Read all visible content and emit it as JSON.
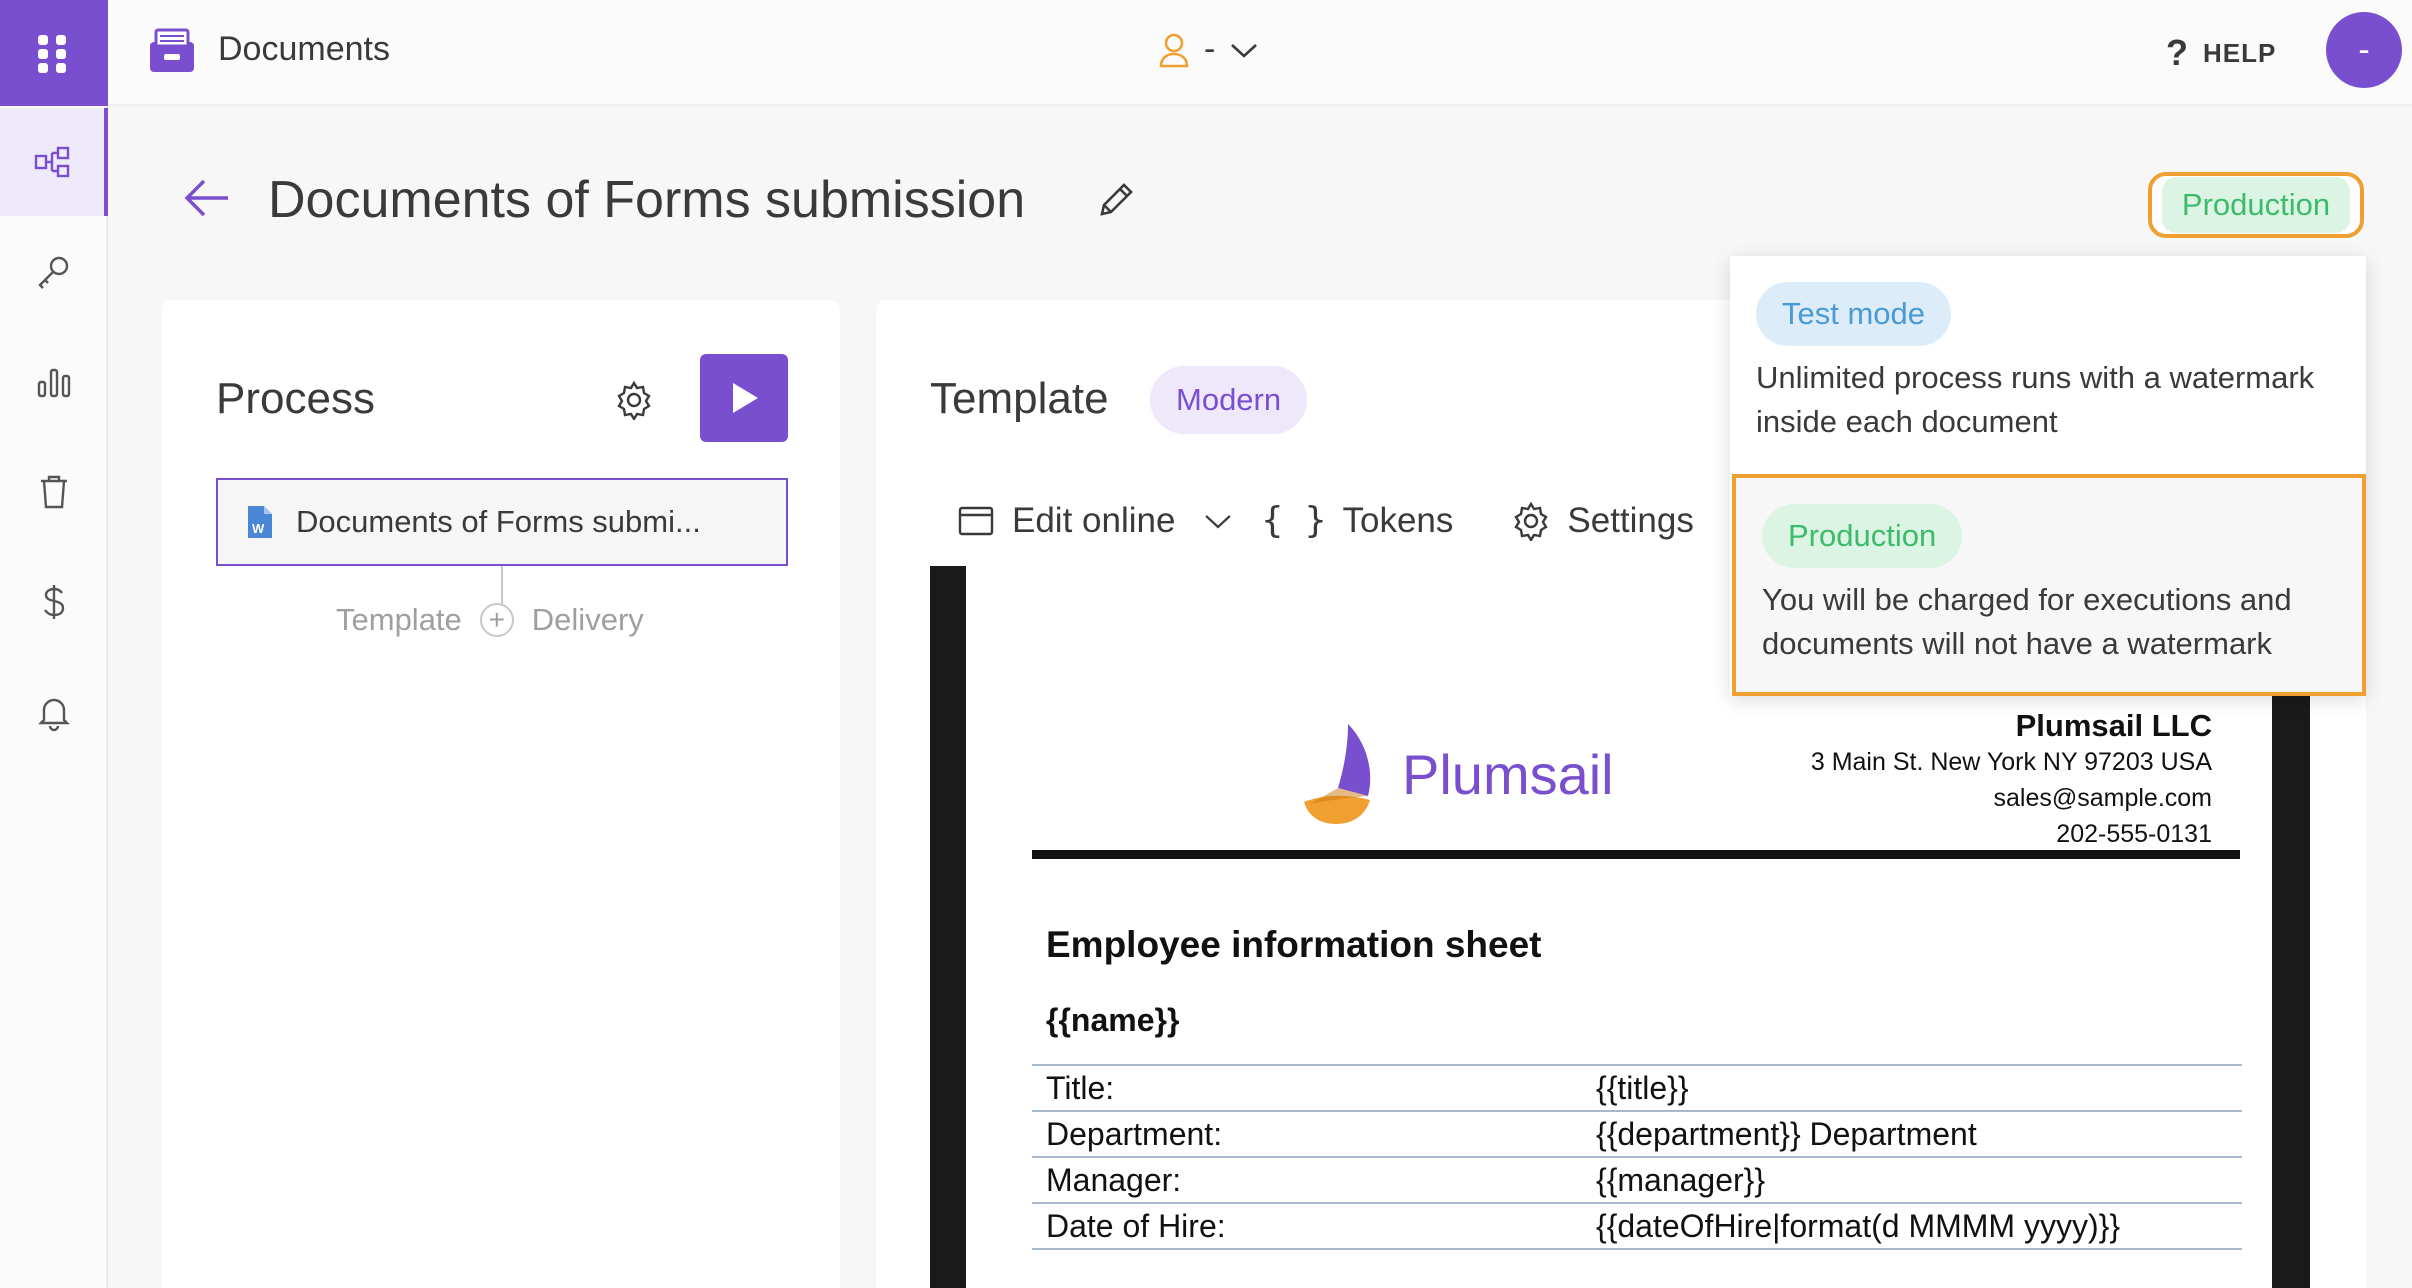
{
  "topbar": {
    "app_title": "Documents",
    "user_label": "-",
    "help_label": "HELP",
    "avatar_text": "-"
  },
  "page": {
    "title": "Documents of Forms submission",
    "mode_badge": "Production"
  },
  "process": {
    "title": "Process",
    "document_name": "Documents of Forms submi...",
    "step_template": "Template",
    "step_delivery": "Delivery"
  },
  "template": {
    "title": "Template",
    "style_badge": "Modern",
    "toolbar": {
      "edit_online": "Edit online",
      "tokens": "Tokens",
      "settings": "Settings"
    }
  },
  "document": {
    "logo_text": "Plumsail",
    "company_name": "Plumsail LLC",
    "address": "3 Main St. New York NY 97203 USA",
    "email": "sales@sample.com",
    "phone": "202-555-0131",
    "sheet_title": "Employee information sheet",
    "name_token": "{{name}}",
    "rows": [
      {
        "label": "Title:",
        "value": "{{title}}"
      },
      {
        "label": "Department:",
        "value": "{{department}} Department"
      },
      {
        "label": "Manager:",
        "value": "{{manager}}"
      },
      {
        "label": "Date of Hire:",
        "value": "{{dateOfHire|format(d MMMM yyyy)}}"
      }
    ]
  },
  "mode_menu": {
    "test": {
      "label": "Test mode",
      "description": "Unlimited process runs with a watermark inside each document"
    },
    "production": {
      "label": "Production",
      "description": "You will be charged for executions and documents will not have a watermark"
    }
  },
  "colors": {
    "accent": "#7a4fcf",
    "highlight": "#f0a030",
    "production_green": "#3dbb6b",
    "test_blue": "#4a9ad6"
  }
}
